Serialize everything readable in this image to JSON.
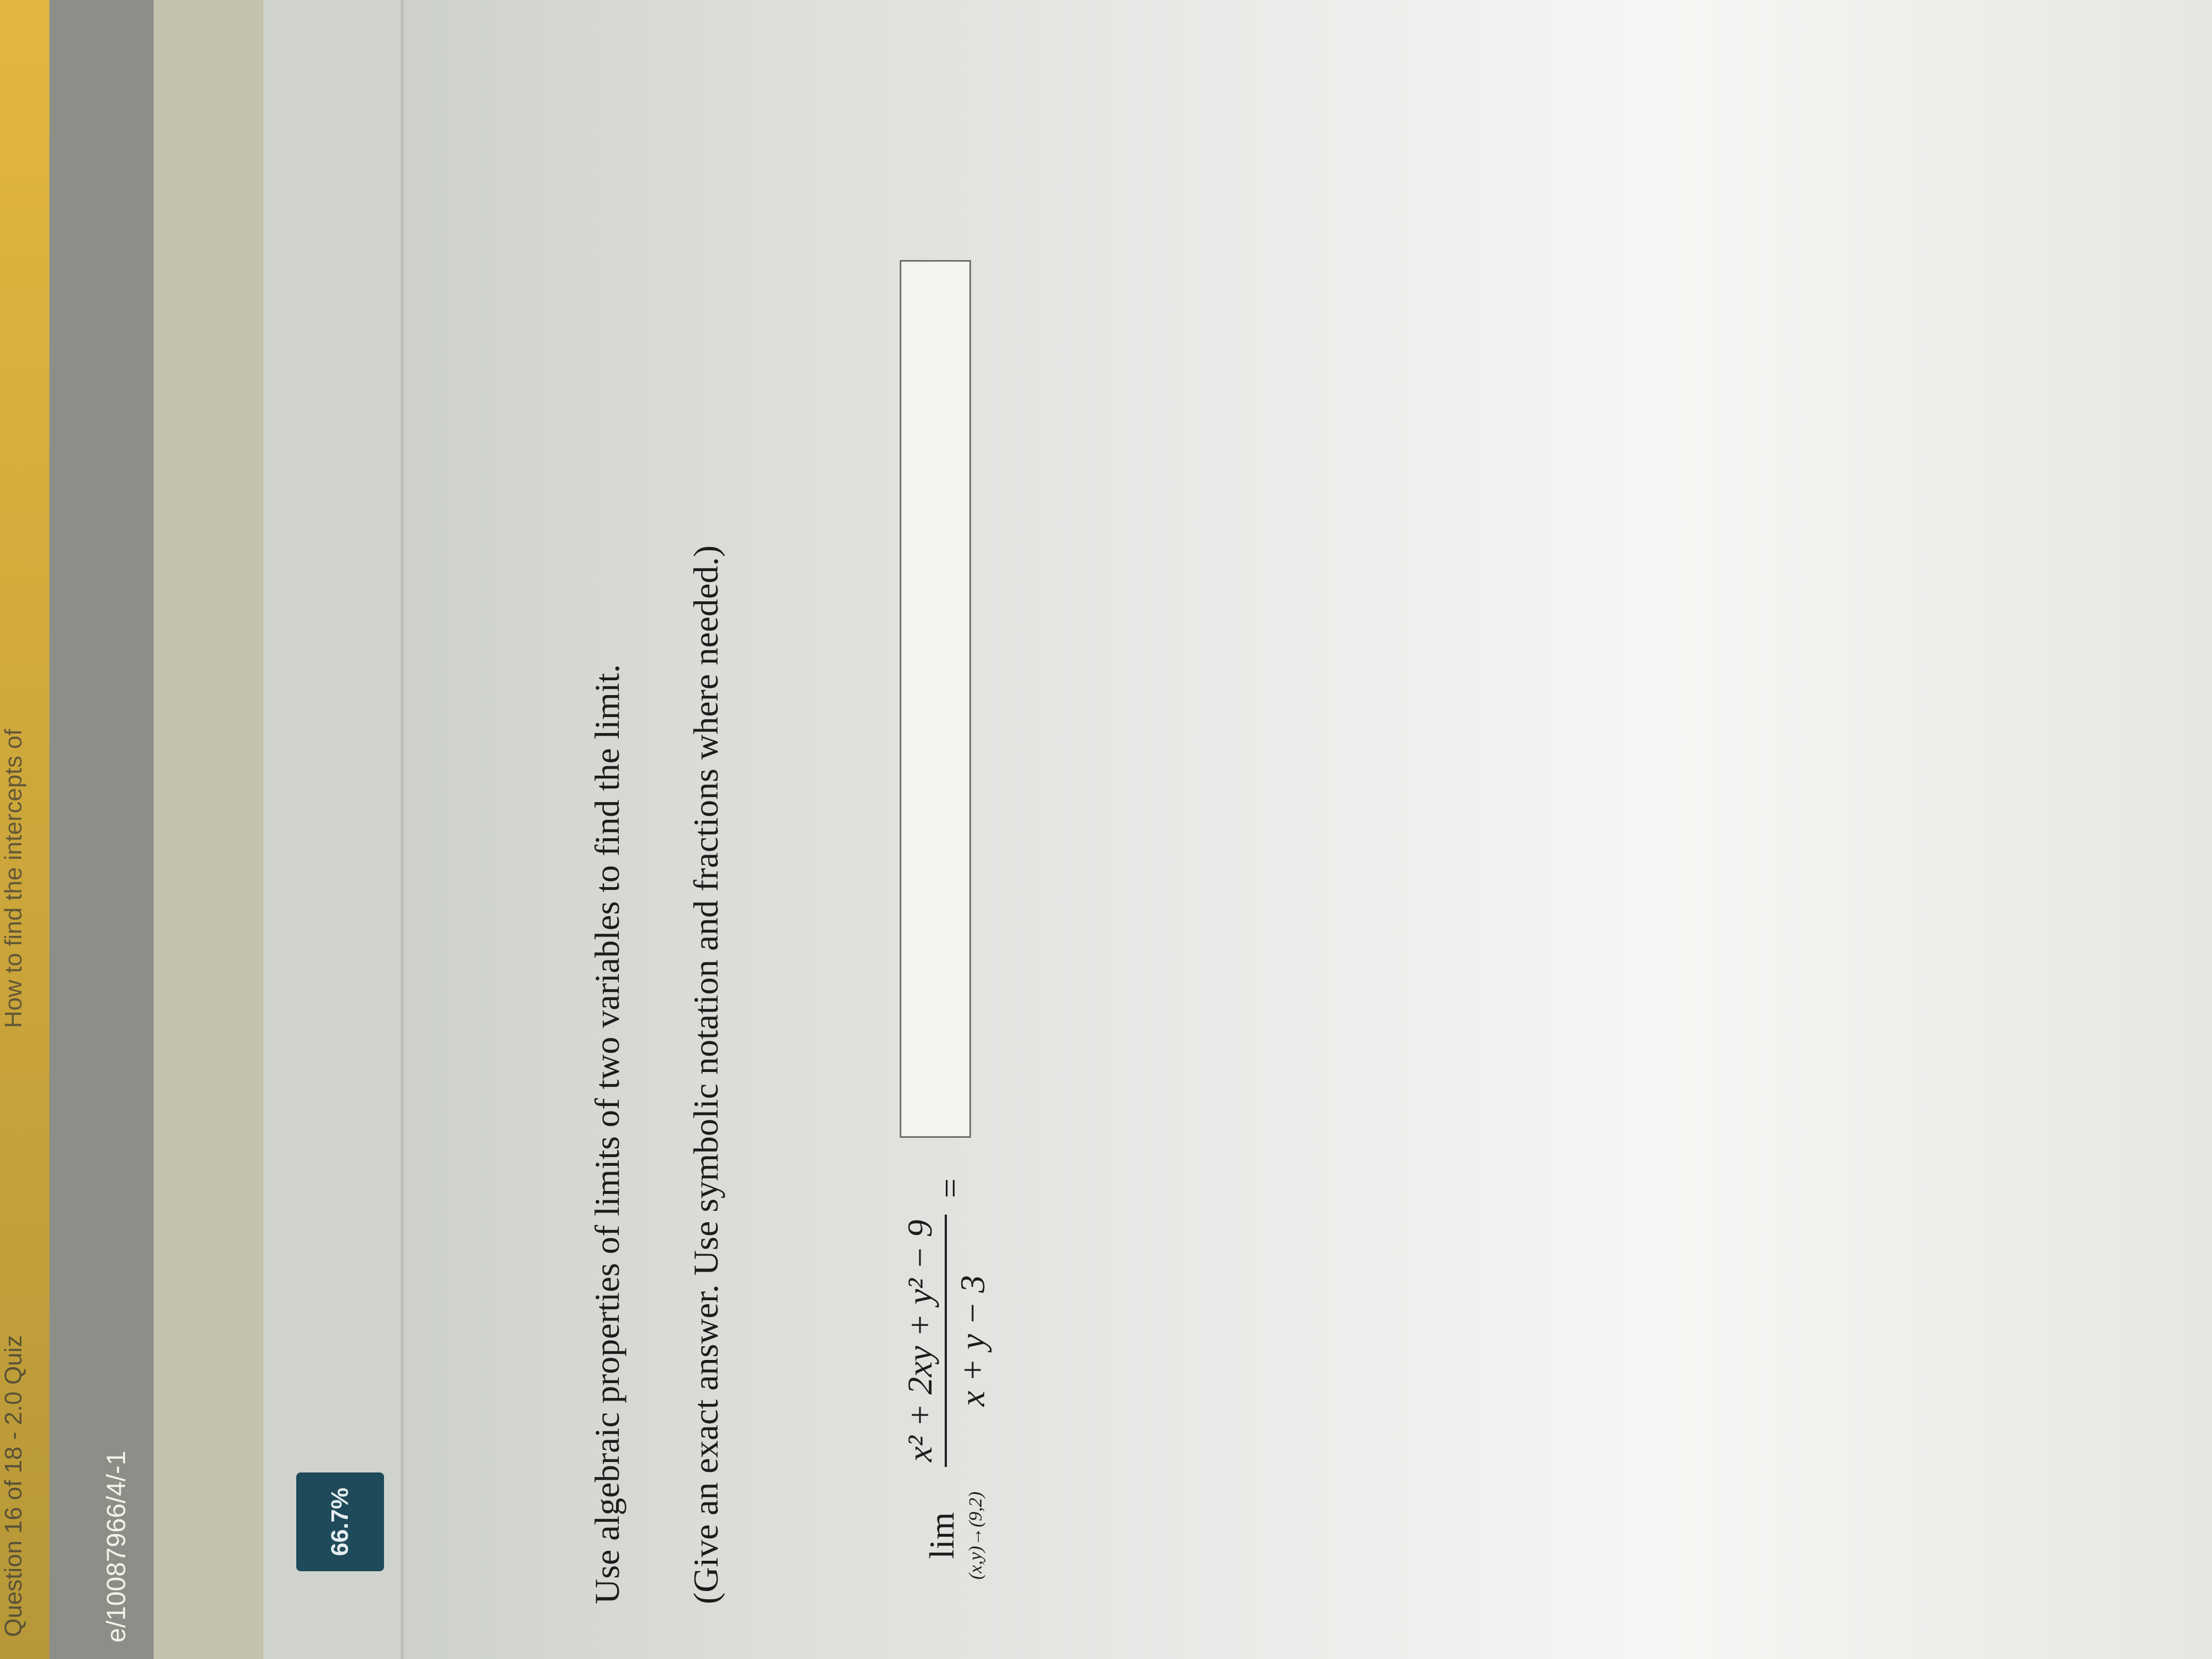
{
  "browser": {
    "tab_title": "Question 16 of 18 - 2.0 Quiz",
    "tab_title_2": "How to find the intercepts of",
    "url_fragment": "e/10087966/4/-1"
  },
  "progress": {
    "percent_label": "66.7%"
  },
  "question": {
    "instruction": "Use algebraic properties of limits of two variables to find the limit.",
    "note": "(Give an exact answer. Use symbolic notation and fractions where needed.)",
    "limit_word": "lim",
    "limit_subscript": "(x,y)→(9,2)",
    "numerator": "x² + 2xy + y² − 9",
    "denominator": "x + y − 3",
    "equals": "=",
    "answer_value": ""
  }
}
